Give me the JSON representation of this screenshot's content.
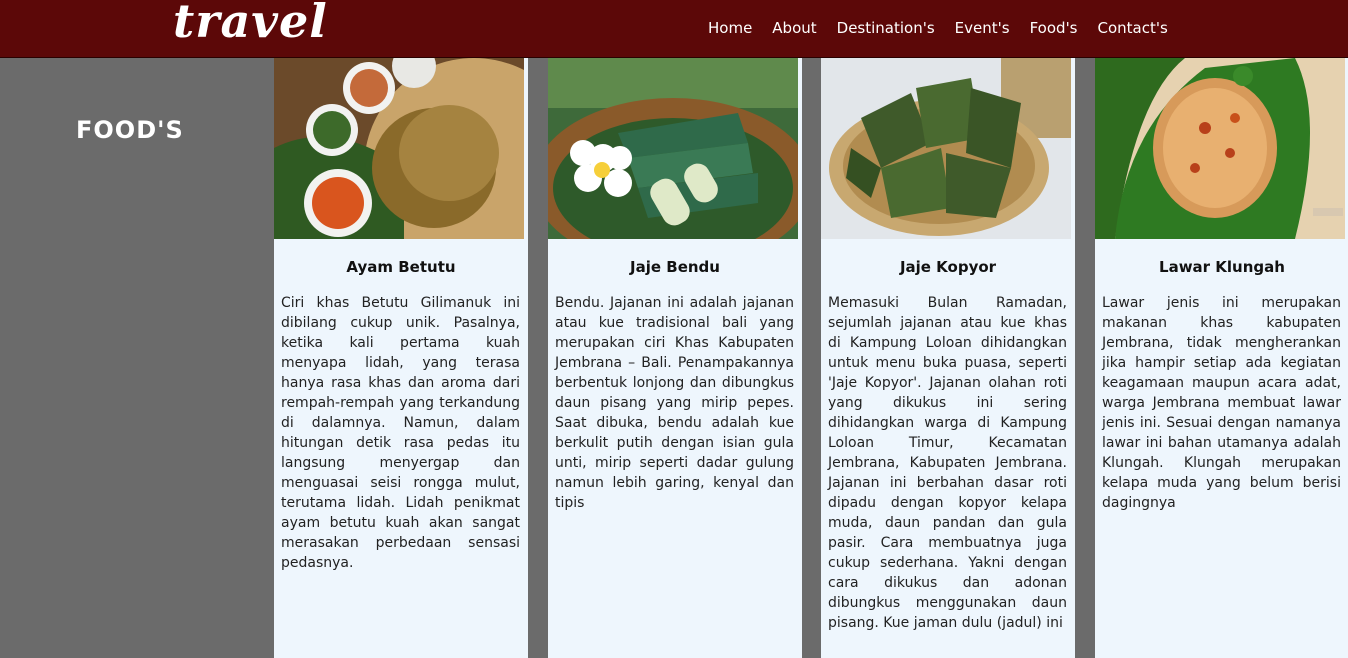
{
  "header": {
    "logo": "travel",
    "nav": [
      "Home",
      "About",
      "Destination's",
      "Event's",
      "Food's",
      "Contact's"
    ]
  },
  "sidebar": {
    "title": "FOOD'S"
  },
  "cards": [
    {
      "title": "Ayam Betutu",
      "image": "ayam-betutu-photo",
      "text": "Ciri khas Betutu Gilimanuk ini dibilang cukup unik. Pasalnya, ketika kali pertama kuah menyapa lidah, yang terasa hanya rasa khas dan aroma dari rempah-rempah yang terkandung di dalamnya. Namun, dalam hitungan detik rasa pedas itu langsung menyergap dan menguasai seisi rongga mulut, terutama lidah. Lidah penikmat ayam betutu kuah akan sangat merasakan perbedaan sensasi pedasnya."
    },
    {
      "title": "Jaje Bendu",
      "image": "jaje-bendu-photo",
      "text": "Bendu. Jajanan ini adalah jajanan atau kue tradisional bali yang merupakan ciri Khas Kabupaten Jembrana – Bali. Penampakannya berbentuk lonjong dan dibungkus daun pisang yang mirip pepes. Saat dibuka, bendu adalah kue berkulit putih dengan isian gula unti, mirip seperti dadar gulung namun lebih garing, kenyal dan tipis"
    },
    {
      "title": "Jaje Kopyor",
      "image": "jaje-kopyor-photo",
      "text": "Memasuki Bulan Ramadan, sejumlah jajanan atau kue khas di Kampung Loloan dihidangkan untuk menu buka puasa, seperti 'Jaje Kopyor'. Jajanan olahan roti yang dikukus ini sering dihidangkan warga di Kampung Loloan Timur, Kecamatan Jembrana, Kabupaten Jembrana. Jajanan ini berbahan dasar roti dipadu dengan kopyor kelapa muda, daun pandan dan gula pasir. Cara membuatnya juga cukup sederhana. Yakni dengan cara dikukus dan adonan dibungkus menggunakan daun pisang. Kue jaman dulu (jadul) ini"
    },
    {
      "title": "Lawar Klungah",
      "image": "lawar-klungah-photo",
      "text": "Lawar jenis ini merupakan makanan khas kabupaten Jembrana, tidak mengherankan jika hampir setiap ada kegiatan keagamaan maupun acara adat, warga Jembrana membuat lawar jenis ini. Sesuai dengan namanya lawar ini bahan utamanya adalah Klungah. Klungah merupakan kelapa muda yang belum berisi dagingnya"
    }
  ]
}
